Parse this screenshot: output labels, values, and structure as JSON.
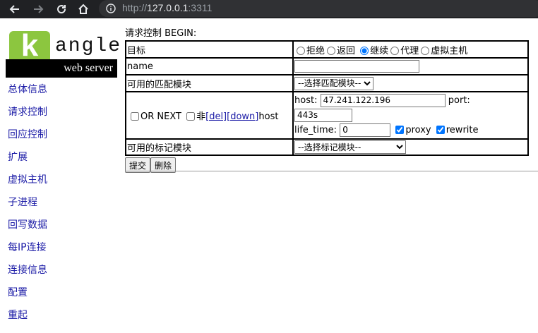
{
  "browser": {
    "url_scheme": "http://",
    "url_host": "127.0.0.1",
    "url_port": ":3311"
  },
  "logo": {
    "k": "k",
    "angle": "angle",
    "subtitle": "web server"
  },
  "sidebar": {
    "items": [
      {
        "label": "总体信息"
      },
      {
        "label": "请求控制"
      },
      {
        "label": "回应控制"
      },
      {
        "label": "扩展"
      },
      {
        "label": "虚拟主机"
      },
      {
        "label": "子进程"
      },
      {
        "label": "回写数据"
      },
      {
        "label": "每IP连接"
      },
      {
        "label": "连接信息"
      },
      {
        "label": "配置"
      },
      {
        "label": "重起"
      }
    ]
  },
  "form": {
    "title": "请求控制 BEGIN:",
    "target_label": "目标",
    "target_options": [
      "拒绝",
      "返回",
      "继续",
      "代理",
      "虚拟主机"
    ],
    "target_selected": "继续",
    "name_label": "name",
    "name_value": "",
    "match_label": "可用的匹配模块",
    "match_select": "--选择匹配模块--",
    "or_next_label": "OR NEXT",
    "not_label": "非",
    "del_link": "[del]",
    "down_link": "[down]",
    "module_name": "host",
    "host_label": "host:",
    "host_value": "47.241.122.196",
    "port_label": "port:",
    "port_value": "443s",
    "life_time_label": "life_time:",
    "life_time_value": "0",
    "proxy_label": "proxy",
    "proxy_checked": true,
    "rewrite_label": "rewrite",
    "rewrite_checked": true,
    "mark_label": "可用的标记模块",
    "mark_select": "--选择标记模块--",
    "submit_label": "提交",
    "delete_label": "删除"
  }
}
